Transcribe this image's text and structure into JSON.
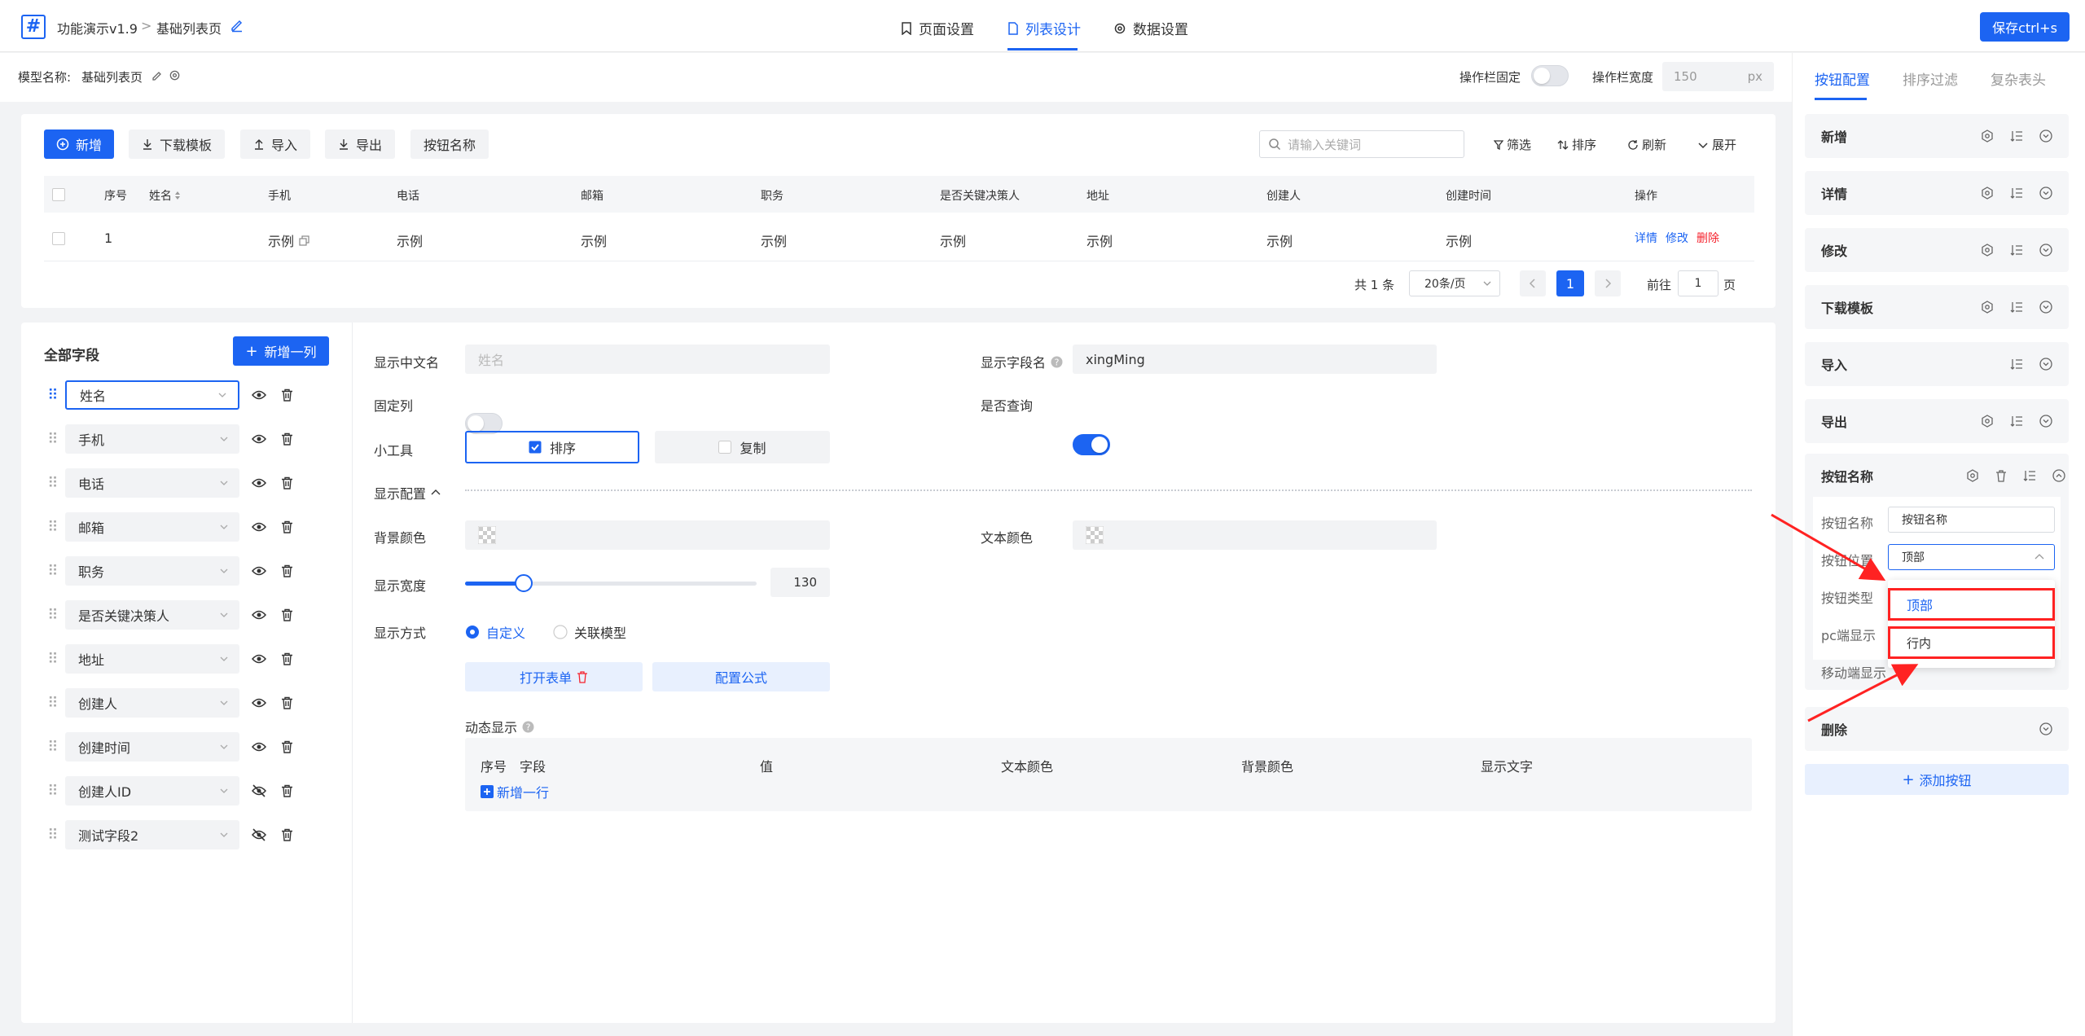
{
  "header": {
    "logo": "#",
    "app_name": "功能演示v1.9",
    "crumb_sep": ">",
    "page_name": "基础列表页",
    "tabs": [
      {
        "label": "页面设置"
      },
      {
        "label": "列表设计"
      },
      {
        "label": "数据设置"
      }
    ],
    "save_label": "保存ctrl+s"
  },
  "model_bar": {
    "model_label": "模型名称:",
    "model_name": "基础列表页",
    "fixed_label": "操作栏固定",
    "width_label": "操作栏宽度",
    "width_value": "150",
    "width_unit": "px"
  },
  "toolbar": {
    "buttons": [
      {
        "label": "新增"
      },
      {
        "label": "下载模板"
      },
      {
        "label": "导入"
      },
      {
        "label": "导出"
      },
      {
        "label": "按钮名称"
      }
    ],
    "search_placeholder": "请输入关键词",
    "filter_label": "筛选",
    "sort_label": "排序",
    "refresh_label": "刷新",
    "expand_label": "展开"
  },
  "table": {
    "headers": [
      "序号",
      "姓名",
      "手机",
      "电话",
      "邮箱",
      "职务",
      "是否关键决策人",
      "地址",
      "创建人",
      "创建时间",
      "操作"
    ],
    "row": {
      "index": "1",
      "phone": "示例",
      "tel": "示例",
      "email": "示例",
      "job": "示例",
      "decision": "示例",
      "address": "示例",
      "creator": "示例",
      "created": "示例"
    },
    "actions": {
      "detail": "详情",
      "edit": "修改",
      "delete": "删除"
    }
  },
  "pagination": {
    "total": "共 1 条",
    "page_size": "20条/页",
    "current": "1",
    "goto_label": "前往",
    "goto_value": "1",
    "page_unit": "页"
  },
  "fields": {
    "title": "全部字段",
    "add_label": "新增一列",
    "items": [
      {
        "label": "姓名"
      },
      {
        "label": "手机"
      },
      {
        "label": "电话"
      },
      {
        "label": "邮箱"
      },
      {
        "label": "职务"
      },
      {
        "label": "是否关键决策人"
      },
      {
        "label": "地址"
      },
      {
        "label": "创建人"
      },
      {
        "label": "创建时间"
      },
      {
        "label": "创建人ID"
      },
      {
        "label": "测试字段2"
      }
    ]
  },
  "form": {
    "cn_name_label": "显示中文名",
    "cn_name_placeholder": "姓名",
    "field_name_label": "显示字段名",
    "field_name_value": "xingMing",
    "fixed_col_label": "固定列",
    "query_label": "是否查询",
    "tools_label": "小工具",
    "tool_sort": "排序",
    "tool_copy": "复制",
    "display_config_label": "显示配置",
    "bg_color_label": "背景颜色",
    "text_color_label": "文本颜色",
    "width_label": "显示宽度",
    "width_value": "130",
    "width_fraction": 0.2,
    "mode_label": "显示方式",
    "mode_custom": "自定义",
    "mode_linked": "关联模型",
    "open_form": "打开表单",
    "config_formula": "配置公式",
    "dynamic_label": "动态显示",
    "dyn_headers": [
      "序号",
      "字段",
      "值",
      "文本颜色",
      "背景颜色",
      "显示文字"
    ],
    "add_row": "新增一行"
  },
  "right": {
    "tabs": [
      "按钮配置",
      "排序过滤",
      "复杂表头"
    ],
    "cards": [
      "新增",
      "详情",
      "修改",
      "下载模板",
      "导入",
      "导出"
    ],
    "expanded": {
      "title": "按钮名称",
      "name_label": "按钮名称",
      "name_value": "按钮名称",
      "pos_label": "按钮位置",
      "pos_value": "顶部",
      "type_label": "按钮类型",
      "pc_label": "pc端显示",
      "mobile_label": "移动端显示",
      "options": [
        "顶部",
        "行内"
      ]
    },
    "delete_card": "删除",
    "add_button": "添加按钮"
  },
  "colors": {
    "accent": "#1c64f2",
    "danger": "#f5222d",
    "annotation": "#ff2222"
  }
}
